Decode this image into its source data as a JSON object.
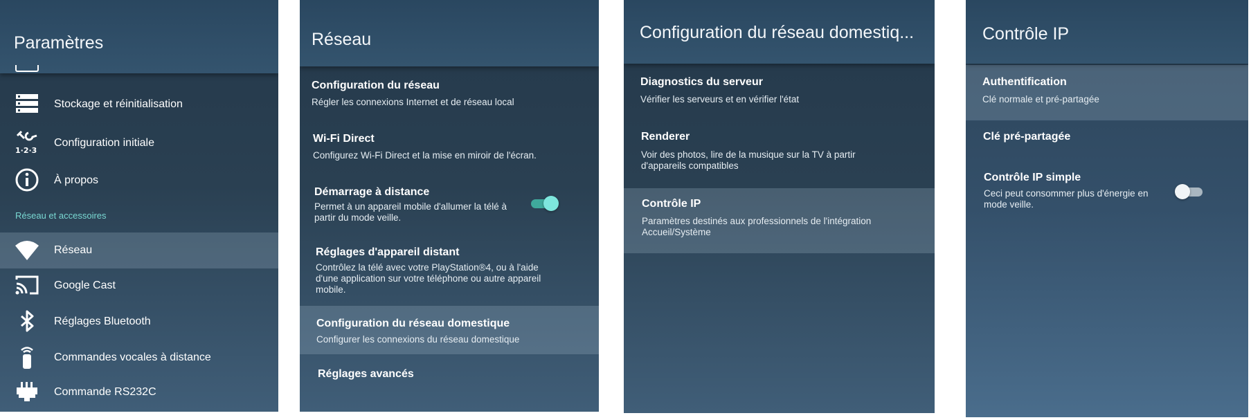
{
  "panel1": {
    "title": "Paramètres",
    "items": [
      {
        "label": "Stockage et réinitialisation",
        "icon": "storage-icon"
      },
      {
        "label": "Configuration initiale",
        "icon": "setup-123-icon"
      },
      {
        "label": "À propos",
        "icon": "info-icon"
      }
    ],
    "section": "Réseau et accessoires",
    "section_items": [
      {
        "label": "Réseau",
        "icon": "wifi-icon",
        "selected": true
      },
      {
        "label": "Google Cast",
        "icon": "cast-icon"
      },
      {
        "label": "Réglages Bluetooth",
        "icon": "bluetooth-icon"
      },
      {
        "label": "Commandes vocales à distance",
        "icon": "remote-icon"
      },
      {
        "label": "Commande RS232C",
        "icon": "serial-port-icon"
      }
    ]
  },
  "panel2": {
    "title": "Réseau",
    "items": [
      {
        "title": "Configuration du réseau",
        "subtitle": "Régler les connexions Internet et de réseau local"
      },
      {
        "title": "Wi-Fi Direct",
        "subtitle": "Configurez Wi-Fi Direct et la mise en miroir de l'écran."
      },
      {
        "title": "Démarrage à distance",
        "subtitle": "Permet à un appareil mobile d'allumer la télé à partir du mode veille.",
        "toggle": "on"
      },
      {
        "title": "Réglages d'appareil distant",
        "subtitle": "Contrôlez la télé avec votre PlayStation®4, ou à l'aide d'une application sur votre téléphone ou autre appareil mobile."
      },
      {
        "title": "Configuration du réseau domestique",
        "subtitle": "Configurer les connexions du réseau domestique",
        "selected": true
      },
      {
        "title": "Réglages avancés",
        "subtitle": ""
      }
    ]
  },
  "panel3": {
    "title": "Configuration du réseau domestiq...",
    "items": [
      {
        "title": "Diagnostics du serveur",
        "subtitle": "Vérifier les serveurs et en vérifier l'état"
      },
      {
        "title": "Renderer",
        "subtitle": "Voir des photos, lire de la musique sur la TV à partir d'appareils compatibles"
      },
      {
        "title": "Contrôle IP",
        "subtitle": "Paramètres destinés aux professionnels de l'intégration Accueil/Système",
        "selected": true
      }
    ]
  },
  "panel4": {
    "title": "Contrôle IP",
    "items": [
      {
        "title": "Authentification",
        "subtitle": "Clé normale et pré-partagée",
        "selected": true
      },
      {
        "title": "Clé pré-partagée",
        "subtitle": ""
      },
      {
        "title": "Contrôle IP simple",
        "subtitle": "Ceci peut consommer plus d'énergie en mode veille.",
        "toggle": "off"
      }
    ]
  },
  "colors": {
    "accent": "#79d8d2",
    "toggle_on": "#3fa99c",
    "background": "#2a4052"
  }
}
